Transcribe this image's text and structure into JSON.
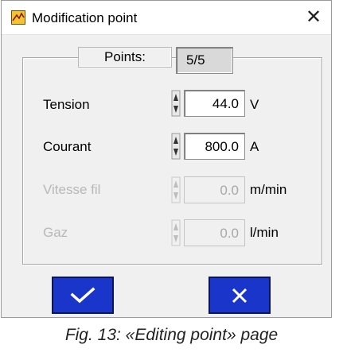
{
  "window": {
    "title": "Modification point",
    "close_glyph": "✕"
  },
  "points": {
    "label": "Points:",
    "value": "5/5"
  },
  "fields": [
    {
      "label": "Tension",
      "value": "44.0",
      "unit": "V",
      "enabled": true
    },
    {
      "label": "Courant",
      "value": "800.0",
      "unit": "A",
      "enabled": true
    },
    {
      "label": "Vitesse fil",
      "value": "0.0",
      "unit": "m/min",
      "enabled": false
    },
    {
      "label": "Gaz",
      "value": "0.0",
      "unit": "l/min",
      "enabled": false
    }
  ],
  "buttons": {
    "confirm_icon": "checkmark-icon",
    "cancel_icon": "cross-icon"
  },
  "caption": "Fig. 13: «Editing point» page",
  "colors": {
    "button_blue": "#1a35c9",
    "disabled_text": "#b8b8b8"
  }
}
